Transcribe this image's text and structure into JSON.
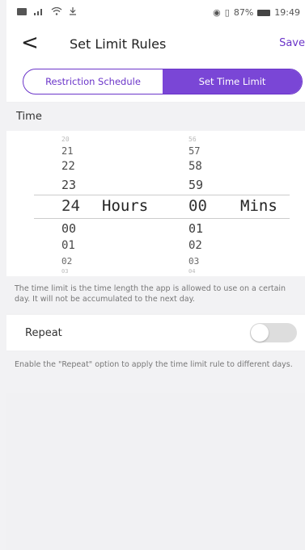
{
  "status_bar": {
    "left_icons": [
      "sim-icon",
      "signal-icon",
      "wifi-icon",
      "download-icon"
    ],
    "eye_icon": "◉",
    "vibrate_icon": "▯",
    "battery": "87%",
    "time": "19:49"
  },
  "header": {
    "back_glyph": "<",
    "title": "Set Limit Rules",
    "save_label": "Save"
  },
  "tabs": [
    {
      "label": "Restriction Schedule",
      "active": false
    },
    {
      "label": "Set Time Limit",
      "active": true
    }
  ],
  "time_section": {
    "label": "Time"
  },
  "picker": {
    "hours_values": [
      "20",
      "21",
      "22",
      "23",
      "24",
      "00",
      "01",
      "02",
      "03"
    ],
    "hours_selected": "24",
    "hours_unit": "Hours",
    "mins_values": [
      "56",
      "57",
      "58",
      "59",
      "00",
      "01",
      "02",
      "03",
      "04"
    ],
    "mins_selected": "00",
    "mins_unit": "Mins"
  },
  "time_note": "The time limit is the time length the app is allowed to use on a certain day. It will not be accumulated to the next day.",
  "repeat": {
    "label": "Repeat",
    "enabled": false
  },
  "repeat_note": "Enable the \"Repeat\" option to apply the time limit rule to different days.",
  "colors": {
    "accent": "#7a46d6",
    "background": "#f2f2f4"
  }
}
